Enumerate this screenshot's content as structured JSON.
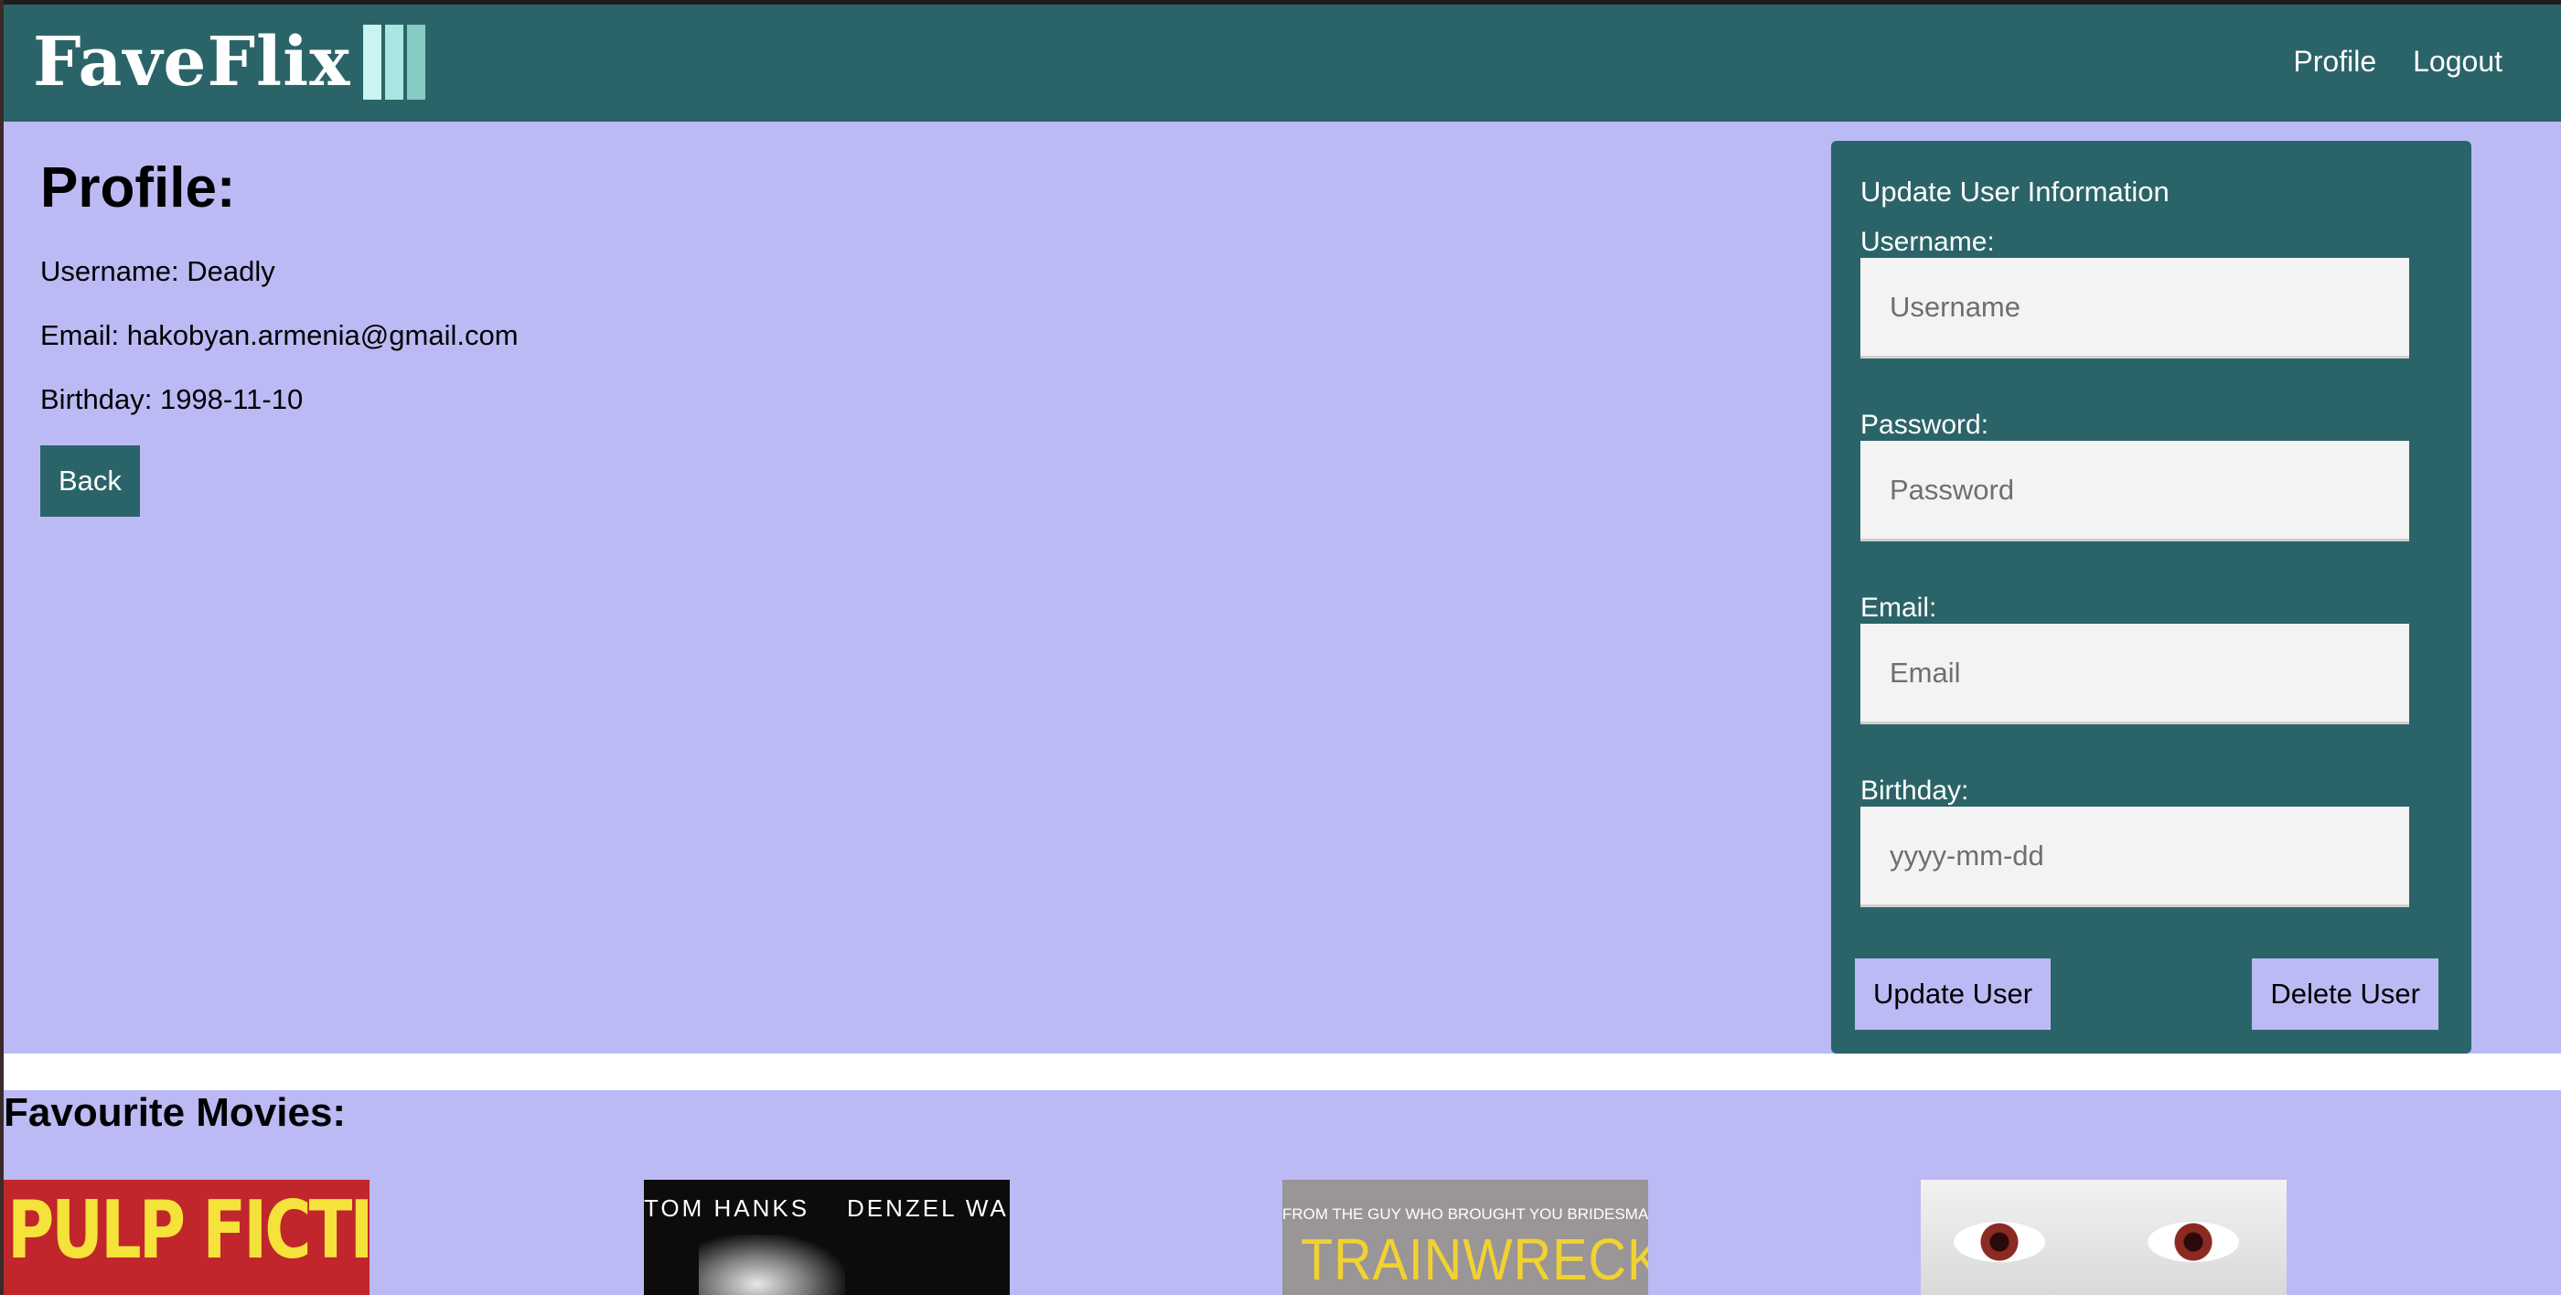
{
  "nav": {
    "brand": "FaveFlix",
    "links": [
      "Profile",
      "Logout"
    ]
  },
  "profile": {
    "title": "Profile:",
    "username": "Username: Deadly",
    "email": "Email: hakobyan.armenia@gmail.com",
    "birthday": "Birthday: 1998-11-10",
    "back_label": "Back"
  },
  "update_form": {
    "title": "Update User Information",
    "fields": [
      {
        "label": "Username:",
        "placeholder": "Username",
        "value": ""
      },
      {
        "label": "Password:",
        "placeholder": "Password",
        "value": ""
      },
      {
        "label": "Email:",
        "placeholder": "Email",
        "value": ""
      },
      {
        "label": "Birthday:",
        "placeholder": "yyyy-mm-dd",
        "value": ""
      }
    ],
    "update_label": "Update User",
    "delete_label": "Delete User"
  },
  "favourites": {
    "title": "Favourite Movies:",
    "posters": [
      {
        "text": "PULP FICTION",
        "color": "#c0262b",
        "text_color": "#f5e23a"
      },
      {
        "text": "TOM HANKS    DENZEL WASHINGTON",
        "color": "#0c0c0c",
        "text_color": "#ffffff"
      },
      {
        "subtext": "FROM THE GUY WHO BROUGHT YOU BRIDESMAIDS",
        "text": "TRAINWRECK",
        "color": "#9a9597",
        "text_color": "#f2d230"
      },
      {
        "text": "",
        "color": "#e9e9e9",
        "text_color": "#000000"
      }
    ]
  },
  "colors": {
    "navbar": "#2b6468",
    "page_bg": "#bcbaf5",
    "brand_bar_colors": [
      "#c9f4ef",
      "#a9e6df",
      "#86cbc4"
    ]
  }
}
